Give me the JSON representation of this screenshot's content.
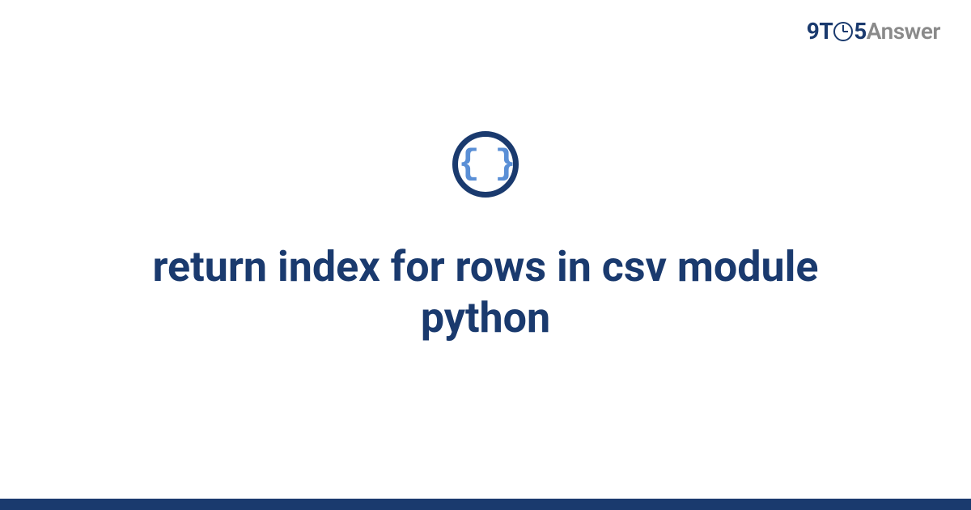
{
  "brand": {
    "part1": "9T",
    "part2": "5",
    "part3": "Answer"
  },
  "icon": {
    "symbol": "{ }",
    "name": "code-braces"
  },
  "title": "return index for rows in csv module python",
  "colors": {
    "primary": "#1a3a6e",
    "accent": "#5a8fd6",
    "muted": "#8a8a8a"
  }
}
